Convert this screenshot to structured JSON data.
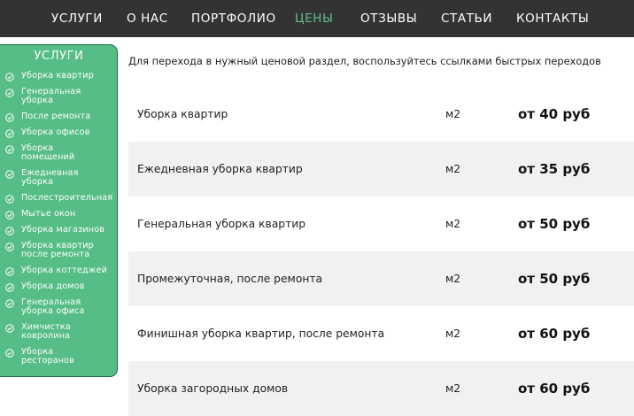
{
  "nav": {
    "items": [
      {
        "label": "УСЛУГИ",
        "active": false
      },
      {
        "label": "О НАС",
        "active": false
      },
      {
        "label": "ПОРТФОЛИО",
        "active": false
      },
      {
        "label": "ЦЕНЫ",
        "active": true
      },
      {
        "label": "ОТЗЫВЫ",
        "active": false
      },
      {
        "label": "СТАТЬИ",
        "active": false
      },
      {
        "label": "КОНТАКТЫ",
        "active": false
      }
    ]
  },
  "sidebar": {
    "title": "УСЛУГИ",
    "items": [
      {
        "line1": "Уборка квартир",
        "line2": ""
      },
      {
        "line1": "Генеральная",
        "line2": "уборка"
      },
      {
        "line1": "После ремонта",
        "line2": ""
      },
      {
        "line1": "Уборка офисов",
        "line2": ""
      },
      {
        "line1": "Уборка",
        "line2": "помещений"
      },
      {
        "line1": "Ежедневная",
        "line2": "уборка"
      },
      {
        "line1": "Послестроительная",
        "line2": ""
      },
      {
        "line1": "Мытье окон",
        "line2": ""
      },
      {
        "line1": "Уборка магазинов",
        "line2": ""
      },
      {
        "line1": "Уборка квартир",
        "line2": "после ремонта"
      },
      {
        "line1": "Уборка коттеджей",
        "line2": ""
      },
      {
        "line1": "Уборка домов",
        "line2": ""
      },
      {
        "line1": "Генеральная",
        "line2": "уборка офиса"
      },
      {
        "line1": "Химчистка",
        "line2": "ковролина"
      },
      {
        "line1": "Уборка",
        "line2": "ресторанов"
      }
    ]
  },
  "intro": "Для перехода в нужный ценовой раздел, воспользуйтесь ссылками быстрых переходов",
  "prices": [
    {
      "name": "Уборка квартир",
      "unit": "м2",
      "price": "от 40 руб"
    },
    {
      "name": "Ежедневная уборка квартир",
      "unit": "м2",
      "price": "от 35 руб"
    },
    {
      "name": "Генеральная уборка квартир",
      "unit": "м2",
      "price": "от 50 руб"
    },
    {
      "name": "Промежуточная, после ремонта",
      "unit": "м2",
      "price": "от 50 руб"
    },
    {
      "name": "Финишная уборка квартир, после ремонта",
      "unit": "м2",
      "price": "от 60 руб"
    },
    {
      "name": "Уборка загородных домов",
      "unit": "м2",
      "price": "от 60 руб"
    }
  ],
  "colors": {
    "nav_bg": "#333333",
    "nav_active": "#5fbf8a",
    "sidebar_bg": "#55bd85",
    "row_shade": "#f1f1f1"
  }
}
